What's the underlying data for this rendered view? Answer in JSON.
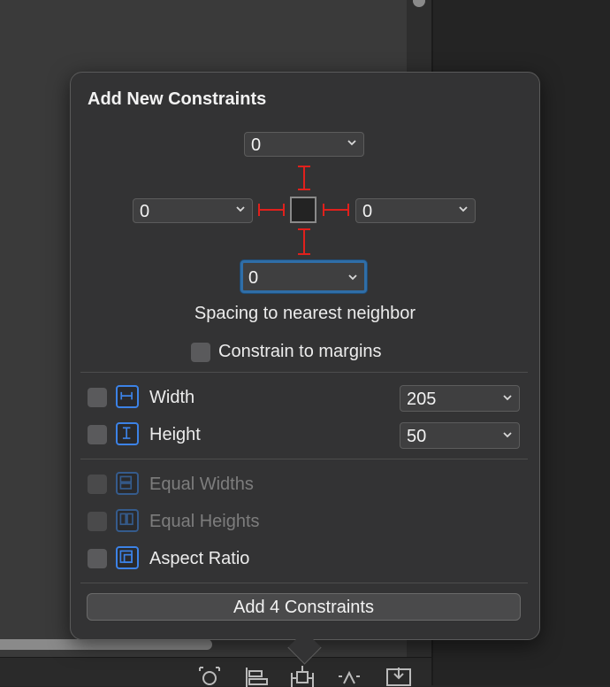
{
  "popover": {
    "title": "Add New Constraints",
    "spacing": {
      "top": "0",
      "leading": "0",
      "trailing": "0",
      "bottom": "0",
      "caption": "Spacing to nearest neighbor"
    },
    "constrain_margins_label": "Constrain to margins",
    "width": {
      "label": "Width",
      "value": "205"
    },
    "height": {
      "label": "Height",
      "value": "50"
    },
    "equal_widths_label": "Equal Widths",
    "equal_heights_label": "Equal Heights",
    "aspect_ratio_label": "Aspect Ratio",
    "add_button_label": "Add 4 Constraints"
  },
  "colors": {
    "accent": "#3c82e6",
    "strut": "#e0201c",
    "focus_ring": "#2f6ea8"
  }
}
